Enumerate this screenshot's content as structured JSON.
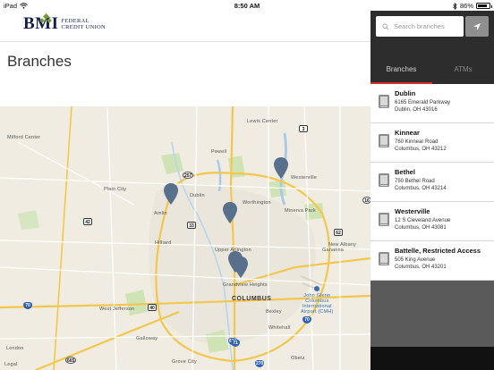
{
  "status_bar": {
    "device": "iPad",
    "time": "8:50 AM",
    "battery_text": "86%",
    "battery_level": 0.86
  },
  "header": {
    "logo_text": "BMI",
    "logo_subtext_line1": "FEDERAL",
    "logo_subtext_line2": "CREDIT UNION"
  },
  "page": {
    "title": "Branches"
  },
  "map": {
    "labels": [
      {
        "text": "Lewis Center",
        "kind": "town"
      },
      {
        "text": "Milford Center",
        "kind": "town"
      },
      {
        "text": "Powell",
        "kind": "town"
      },
      {
        "text": "Westerville",
        "kind": "town"
      },
      {
        "text": "Plain City",
        "kind": "town"
      },
      {
        "text": "Dublin",
        "kind": "town"
      },
      {
        "text": "Amlin",
        "kind": "town"
      },
      {
        "text": "Worthington",
        "kind": "town"
      },
      {
        "text": "Minerva Park",
        "kind": "town"
      },
      {
        "text": "Hilliard",
        "kind": "town"
      },
      {
        "text": "New Albany",
        "kind": "town"
      },
      {
        "text": "Gahanna",
        "kind": "town"
      },
      {
        "text": "Upper Arlington",
        "kind": "town"
      },
      {
        "text": "Grandview Heights",
        "kind": "town"
      },
      {
        "text": "COLUMBUS",
        "kind": "city"
      },
      {
        "text": "West Jefferson",
        "kind": "town"
      },
      {
        "text": "Bexley",
        "kind": "town"
      },
      {
        "text": "Whitehall",
        "kind": "town"
      },
      {
        "text": "Galloway",
        "kind": "town"
      },
      {
        "text": "London",
        "kind": "town"
      },
      {
        "text": "Grove City",
        "kind": "town"
      },
      {
        "text": "Obetz",
        "kind": "town"
      },
      {
        "text": "Legal",
        "kind": "town"
      }
    ],
    "airport": {
      "line1": "John Glenn",
      "line2": "Columbus",
      "line3": "International",
      "line4": "Airport (CMH)"
    },
    "shields": [
      {
        "text": "3",
        "kind": "us"
      },
      {
        "text": "257",
        "kind": "sr"
      },
      {
        "text": "42",
        "kind": "us"
      },
      {
        "text": "33",
        "kind": "us"
      },
      {
        "text": "62",
        "kind": "us"
      },
      {
        "text": "16",
        "kind": "sr"
      },
      {
        "text": "70",
        "kind": "i"
      },
      {
        "text": "40",
        "kind": "us"
      },
      {
        "text": "670",
        "kind": "i"
      },
      {
        "text": "70",
        "kind": "i"
      },
      {
        "text": "71",
        "kind": "i"
      },
      {
        "text": "665",
        "kind": "sr"
      },
      {
        "text": "270",
        "kind": "i"
      }
    ]
  },
  "panel": {
    "search_placeholder": "Search branches",
    "tabs": [
      {
        "label": "Branches",
        "active": true
      },
      {
        "label": "ATMs",
        "active": false
      }
    ],
    "branches": [
      {
        "name": "Dublin",
        "address1": "6165 Emerald Parkway",
        "address2": "Dublin, OH 43016"
      },
      {
        "name": "Kinnear",
        "address1": "760 Kinnear Road",
        "address2": "Columbus, OH 43212"
      },
      {
        "name": "Bethel",
        "address1": "750 Bethel Road",
        "address2": "Columbus, OH 43214"
      },
      {
        "name": "Westerville",
        "address1": "12 S Cleveland Avenue",
        "address2": "Columbus, OH 43081"
      },
      {
        "name": "Battelle, Restricted Access",
        "address1": "505 King Avenue",
        "address2": "Columbus, OH 43201"
      }
    ]
  },
  "colors": {
    "brand_navy": "#101e4c",
    "brand_green": "#7a9a2e",
    "tab_accent": "#d32f2f",
    "pin": "#58708c",
    "panel_dark": "#2d2d2d"
  }
}
